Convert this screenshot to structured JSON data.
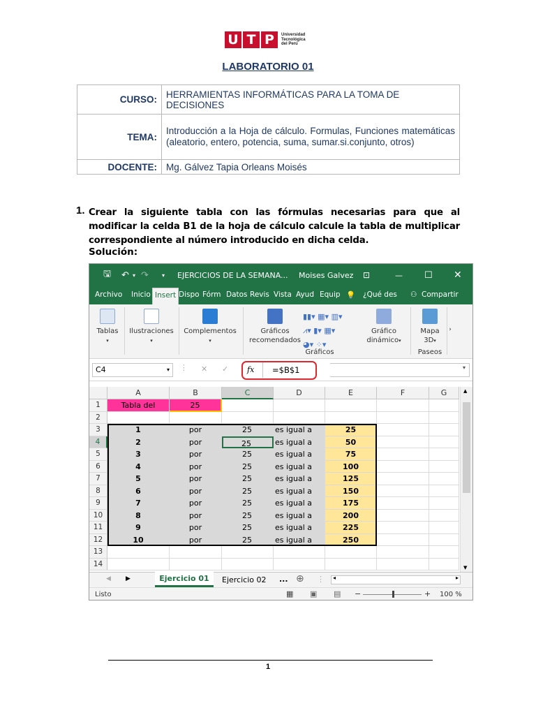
{
  "logo": {
    "letters": [
      "U",
      "T",
      "P"
    ],
    "uni_line1": "Universidad",
    "uni_line2": "Tecnológica",
    "uni_line3": "del Perú"
  },
  "doc_title": "LABORATORIO 01",
  "info": [
    {
      "label": "CURSO:",
      "value": "HERRAMIENTAS INFORMÁTICAS PARA LA TOMA DE DECISIONES"
    },
    {
      "label": "TEMA:",
      "value": "Introducción a la Hoja de cálculo. Formulas, Funciones matemáticas (aleatorio, entero, potencia, suma, sumar.si.conjunto, otros)"
    },
    {
      "label": "DOCENTE:",
      "value": "Mg. Gálvez Tapia Orleans Moisés"
    }
  ],
  "exercise_number": "1.",
  "exercise_text": "Crear la siguiente tabla con las fórmulas necesarias para que al modificar la celda B1 de la hoja de cálculo calcule la tabla de multiplicar correspondiente al número introducido en dicha celda.",
  "solution_label": "Solución:",
  "excel": {
    "window_title": "EJERCICIOS DE LA SEMANA...",
    "user": "Moises Galvez",
    "tabs": [
      "Archivo",
      "Inicio",
      "Insert",
      "Dispo",
      "Fórm",
      "Datos",
      "Revis",
      "Vista",
      "Ayud",
      "Equip"
    ],
    "tell_me": "¿Qué des",
    "share": "Compartir",
    "ribbon": {
      "tablas": "Tablas",
      "ilustraciones": "Ilustraciones",
      "complementos": "Complementos",
      "graficos_rec_1": "Gráficos",
      "graficos_rec_2": "recomendados",
      "grafico_din_1": "Gráfico",
      "grafico_din_2": "dinámico",
      "mapa_1": "Mapa",
      "mapa_2": "3D",
      "group_graficos": "Gráficos",
      "group_paseos": "Paseos"
    },
    "name_box": "C4",
    "fx": "fx",
    "formula": "=$B$1",
    "columns": [
      "A",
      "B",
      "C",
      "D",
      "E",
      "F",
      "G"
    ],
    "cell_A1": "Tabla del",
    "cell_B1": "25",
    "rows": [
      {
        "a": "1",
        "b": "por",
        "c": "25",
        "d": "es igual a",
        "e": "25"
      },
      {
        "a": "2",
        "b": "por",
        "c": "25",
        "d": "es igual a",
        "e": "50"
      },
      {
        "a": "3",
        "b": "por",
        "c": "25",
        "d": "es igual a",
        "e": "75"
      },
      {
        "a": "4",
        "b": "por",
        "c": "25",
        "d": "es igual a",
        "e": "100"
      },
      {
        "a": "5",
        "b": "por",
        "c": "25",
        "d": "es igual a",
        "e": "125"
      },
      {
        "a": "6",
        "b": "por",
        "c": "25",
        "d": "es igual a",
        "e": "150"
      },
      {
        "a": "7",
        "b": "por",
        "c": "25",
        "d": "es igual a",
        "e": "175"
      },
      {
        "a": "8",
        "b": "por",
        "c": "25",
        "d": "es igual a",
        "e": "200"
      },
      {
        "a": "9",
        "b": "por",
        "c": "25",
        "d": "es igual a",
        "e": "225"
      },
      {
        "a": "10",
        "b": "por",
        "c": "25",
        "d": "es igual a",
        "e": "250"
      }
    ],
    "row_numbers": [
      "1",
      "2",
      "3",
      "4",
      "5",
      "6",
      "7",
      "8",
      "9",
      "10",
      "11",
      "12",
      "13",
      "14"
    ],
    "sheet_tabs": [
      "Ejercicio 01",
      "Ejercicio 02"
    ],
    "more_tabs": "...",
    "status_ready": "Listo",
    "zoom": "100 %",
    "colors": {
      "green": "#217346",
      "pink": "#ff3399",
      "gray": "#d9d9d9",
      "yellow": "#ffe699",
      "red": "#e0262d"
    }
  },
  "page_number": "1"
}
